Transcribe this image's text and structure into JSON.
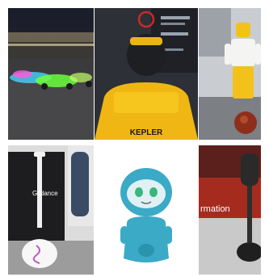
{
  "photos": [
    {
      "label": "race-car-lights",
      "sign_text": ""
    },
    {
      "label": "kepler-humanoid-robot",
      "sign_text": "KEPLER"
    },
    {
      "label": "yellow-humanoid-robot",
      "sign_text": ""
    },
    {
      "label": "glidance-robot",
      "sign_text": "Glidance"
    },
    {
      "label": "moxie-companion-robot",
      "sign_text": ""
    },
    {
      "label": "booth-robot",
      "sign_text": "rmation"
    }
  ]
}
